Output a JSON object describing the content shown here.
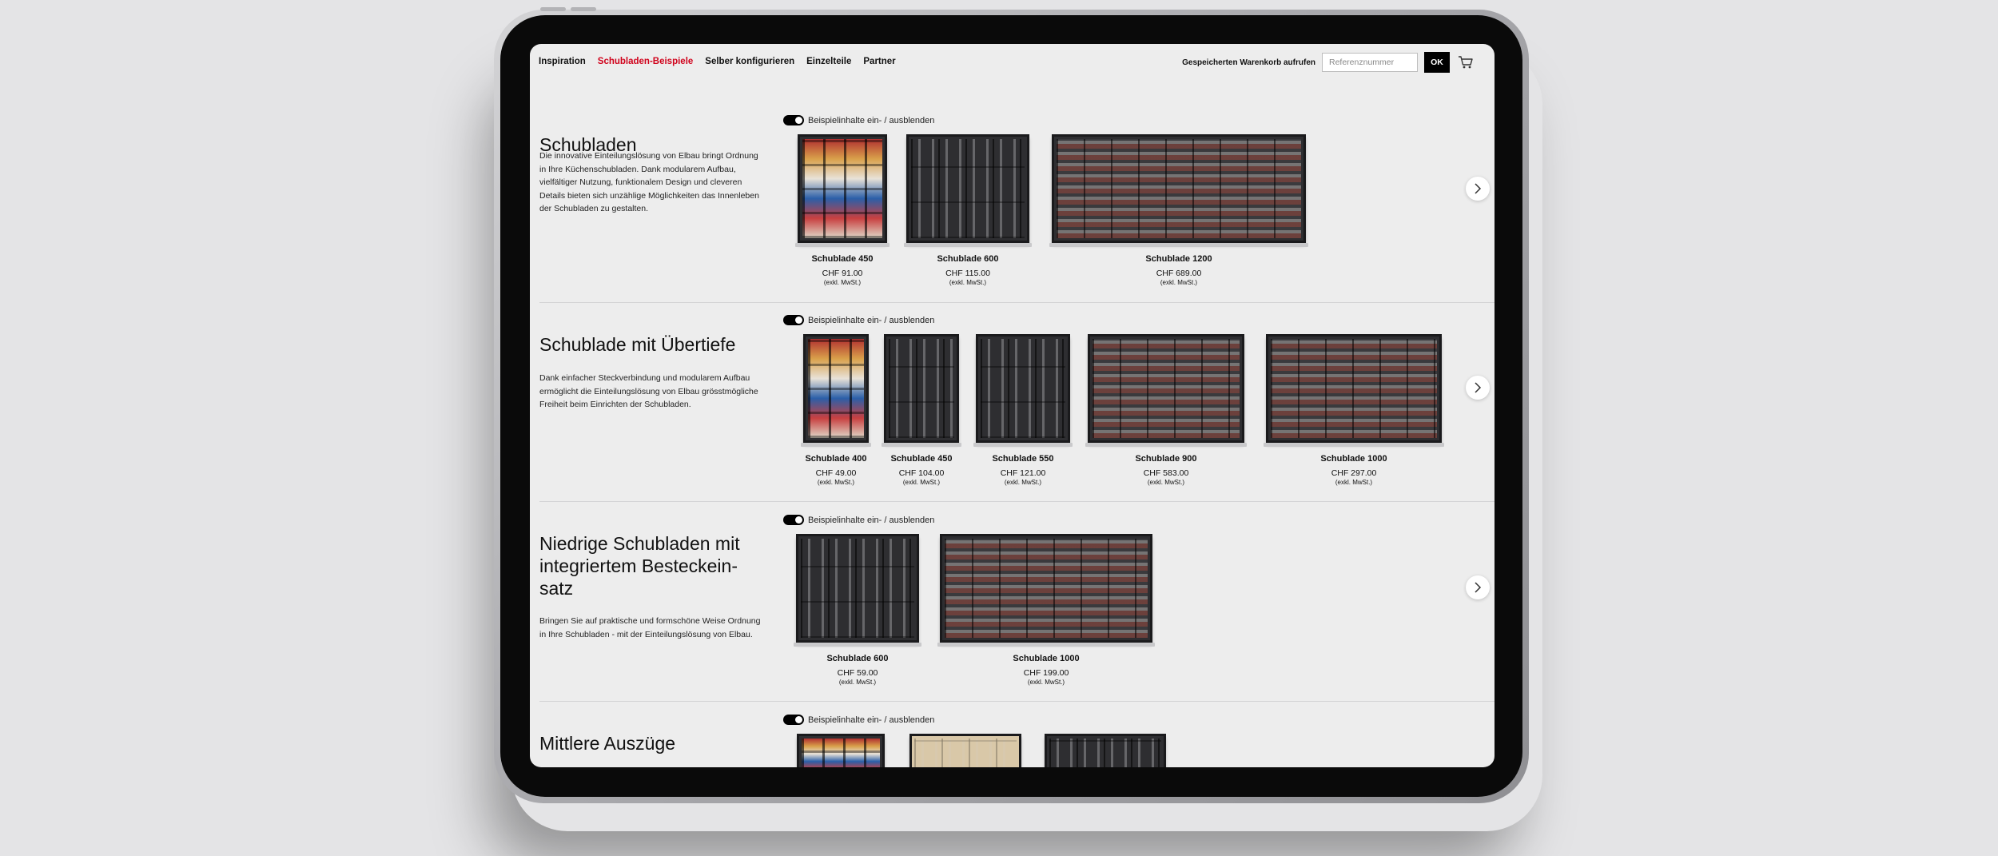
{
  "nav": {
    "links": [
      "Inspiration",
      "Schubladen-Beispiele",
      "Selber konfigurieren",
      "Einzelteile",
      "Partner"
    ],
    "active_index": 1,
    "saved_cart_label": "Gespeicherten Warenkorb aufrufen",
    "reference_placeholder": "Referenznummer",
    "ok_label": "OK",
    "cart_icon": "shopping-cart-icon"
  },
  "colors": {
    "accent": "#d0021b",
    "background": "#ededed",
    "button": "#000000"
  },
  "sections": [
    {
      "title": "Schubladen",
      "description": "Die innovative Einteilungslösung von Elbau bringt Ordnung in Ihre Küchenschubladen. Dank modularem Aufbau, vielfältiger Nutzung, funktionalem Design und cleveren Details bieten sich unzählige Möglichkeiten das Innenleben der Schubladen zu gestalten.",
      "toggle_label": "Beispielinhalte ein- / ausblenden",
      "products": [
        {
          "name": "Schublade 450",
          "price": "CHF 91.00",
          "tax": "(exkl. MwSt.)"
        },
        {
          "name": "Schublade 600",
          "price": "CHF 115.00",
          "tax": "(exkl. MwSt.)"
        },
        {
          "name": "Schublade 1200",
          "price": "CHF 689.00",
          "tax": "(exkl. MwSt.)"
        }
      ]
    },
    {
      "title": "Schublade mit Übertiefe",
      "description": "Dank einfacher Steckverbindung und modularem Aufbau ermöglicht die Einteilungslösung von Elbau grösstmögliche Freiheit beim Einrichten der Schubladen.",
      "toggle_label": "Beispielinhalte ein- / ausblenden",
      "products": [
        {
          "name": "Schublade 400",
          "price": "CHF 49.00",
          "tax": "(exkl. MwSt.)"
        },
        {
          "name": "Schublade 450",
          "price": "CHF 104.00",
          "tax": "(exkl. MwSt.)"
        },
        {
          "name": "Schublade 550",
          "price": "CHF 121.00",
          "tax": "(exkl. MwSt.)"
        },
        {
          "name": "Schublade 900",
          "price": "CHF 583.00",
          "tax": "(exkl. MwSt.)"
        },
        {
          "name": "Schublade 1000",
          "price": "CHF 297.00",
          "tax": "(exkl. MwSt.)"
        }
      ]
    },
    {
      "title": "Niedrige Schubladen mit integriertem Besteckein-satz",
      "description": "Bringen Sie auf praktische und formschöne Weise Ordnung in Ihre Schubladen - mit der Einteilungslösung von Elbau.",
      "toggle_label": "Beispielinhalte ein- / ausblenden",
      "products": [
        {
          "name": "Schublade 600",
          "price": "CHF 59.00",
          "tax": "(exkl. MwSt.)"
        },
        {
          "name": "Schublade 1000",
          "price": "CHF 199.00",
          "tax": "(exkl. MwSt.)"
        }
      ]
    },
    {
      "title": "Mittlere Auszüge",
      "toggle_label": "Beispielinhalte ein- / ausblenden"
    }
  ]
}
